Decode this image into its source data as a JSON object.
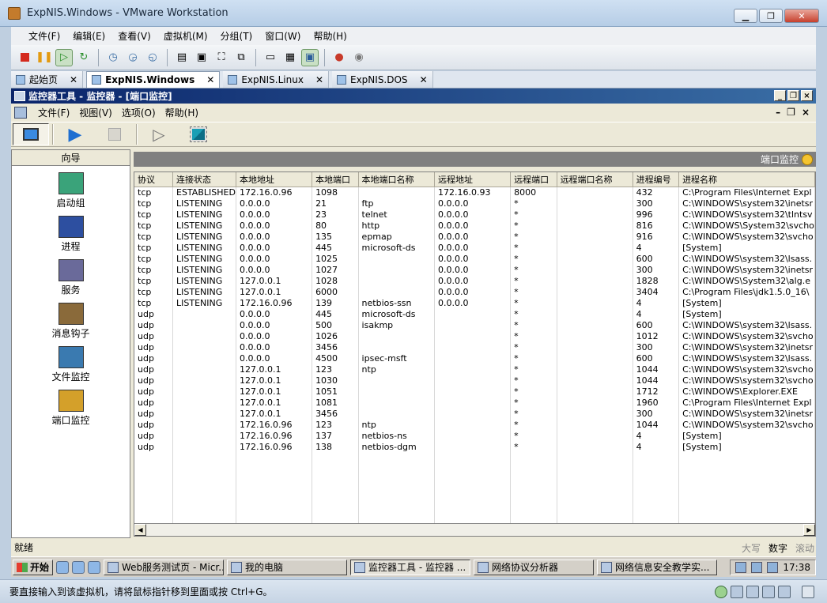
{
  "vm": {
    "title": "ExpNIS.Windows - VMware Workstation",
    "menu": [
      "文件(F)",
      "编辑(E)",
      "查看(V)",
      "虚拟机(M)",
      "分组(T)",
      "窗口(W)",
      "帮助(H)"
    ],
    "tabs": [
      {
        "label": "起始页",
        "active": false
      },
      {
        "label": "ExpNIS.Windows",
        "active": true
      },
      {
        "label": "ExpNIS.Linux",
        "active": false
      },
      {
        "label": "ExpNIS.DOS",
        "active": false
      }
    ],
    "status_text": "要直接输入到该虚拟机，请将鼠标指针移到里面或按 Ctrl+G。"
  },
  "app": {
    "title": "监控器工具 - 监控器 - [端口监控]",
    "menu": [
      "文件(F)",
      "视图(V)",
      "选项(O)",
      "帮助(H)"
    ],
    "nav_header": "向导",
    "nav_items": [
      {
        "label": "启动组",
        "icon": "startup-group-icon"
      },
      {
        "label": "进程",
        "icon": "process-icon"
      },
      {
        "label": "服务",
        "icon": "service-icon"
      },
      {
        "label": "消息钩子",
        "icon": "message-hook-icon"
      },
      {
        "label": "文件监控",
        "icon": "file-monitor-icon"
      },
      {
        "label": "端口监控",
        "icon": "port-monitor-icon"
      }
    ],
    "panel_title": "端口监控",
    "status": "就绪",
    "indicators": [
      "大写",
      "数字",
      "滚动"
    ]
  },
  "table": {
    "columns": [
      "协议",
      "连接状态",
      "本地地址",
      "本地端口",
      "本地端口名称",
      "远程地址",
      "远程端口",
      "远程端口名称",
      "进程编号",
      "进程名称"
    ],
    "rows": [
      [
        "tcp",
        "ESTABLISHED",
        "172.16.0.96",
        "1098",
        "",
        "172.16.0.93",
        "8000",
        "",
        "432",
        "C:\\Program Files\\Internet Expl"
      ],
      [
        "tcp",
        "LISTENING",
        "0.0.0.0",
        "21",
        "ftp",
        "0.0.0.0",
        "*",
        "",
        "300",
        "C:\\WINDOWS\\system32\\inetsr"
      ],
      [
        "tcp",
        "LISTENING",
        "0.0.0.0",
        "23",
        "telnet",
        "0.0.0.0",
        "*",
        "",
        "996",
        "C:\\WINDOWS\\system32\\tlntsv"
      ],
      [
        "tcp",
        "LISTENING",
        "0.0.0.0",
        "80",
        "http",
        "0.0.0.0",
        "*",
        "",
        "816",
        "C:\\WINDOWS\\System32\\svcho"
      ],
      [
        "tcp",
        "LISTENING",
        "0.0.0.0",
        "135",
        "epmap",
        "0.0.0.0",
        "*",
        "",
        "916",
        "C:\\WINDOWS\\system32\\svcho"
      ],
      [
        "tcp",
        "LISTENING",
        "0.0.0.0",
        "445",
        "microsoft-ds",
        "0.0.0.0",
        "*",
        "",
        "4",
        "[System]"
      ],
      [
        "tcp",
        "LISTENING",
        "0.0.0.0",
        "1025",
        "",
        "0.0.0.0",
        "*",
        "",
        "600",
        "C:\\WINDOWS\\system32\\lsass."
      ],
      [
        "tcp",
        "LISTENING",
        "0.0.0.0",
        "1027",
        "",
        "0.0.0.0",
        "*",
        "",
        "300",
        "C:\\WINDOWS\\system32\\inetsr"
      ],
      [
        "tcp",
        "LISTENING",
        "127.0.0.1",
        "1028",
        "",
        "0.0.0.0",
        "*",
        "",
        "1828",
        "C:\\WINDOWS\\System32\\alg.e"
      ],
      [
        "tcp",
        "LISTENING",
        "127.0.0.1",
        "6000",
        "",
        "0.0.0.0",
        "*",
        "",
        "3404",
        "C:\\Program Files\\jdk1.5.0_16\\"
      ],
      [
        "tcp",
        "LISTENING",
        "172.16.0.96",
        "139",
        "netbios-ssn",
        "0.0.0.0",
        "*",
        "",
        "4",
        "[System]"
      ],
      [
        "udp",
        "",
        "0.0.0.0",
        "445",
        "microsoft-ds",
        "",
        "*",
        "",
        "4",
        "[System]"
      ],
      [
        "udp",
        "",
        "0.0.0.0",
        "500",
        "isakmp",
        "",
        "*",
        "",
        "600",
        "C:\\WINDOWS\\system32\\lsass."
      ],
      [
        "udp",
        "",
        "0.0.0.0",
        "1026",
        "",
        "",
        "*",
        "",
        "1012",
        "C:\\WINDOWS\\system32\\svcho"
      ],
      [
        "udp",
        "",
        "0.0.0.0",
        "3456",
        "",
        "",
        "*",
        "",
        "300",
        "C:\\WINDOWS\\system32\\inetsr"
      ],
      [
        "udp",
        "",
        "0.0.0.0",
        "4500",
        "ipsec-msft",
        "",
        "*",
        "",
        "600",
        "C:\\WINDOWS\\system32\\lsass."
      ],
      [
        "udp",
        "",
        "127.0.0.1",
        "123",
        "ntp",
        "",
        "*",
        "",
        "1044",
        "C:\\WINDOWS\\system32\\svcho"
      ],
      [
        "udp",
        "",
        "127.0.0.1",
        "1030",
        "",
        "",
        "*",
        "",
        "1044",
        "C:\\WINDOWS\\system32\\svcho"
      ],
      [
        "udp",
        "",
        "127.0.0.1",
        "1051",
        "",
        "",
        "*",
        "",
        "1712",
        "C:\\WINDOWS\\Explorer.EXE"
      ],
      [
        "udp",
        "",
        "127.0.0.1",
        "1081",
        "",
        "",
        "*",
        "",
        "1960",
        "C:\\Program Files\\Internet Expl"
      ],
      [
        "udp",
        "",
        "127.0.0.1",
        "3456",
        "",
        "",
        "*",
        "",
        "300",
        "C:\\WINDOWS\\system32\\inetsr"
      ],
      [
        "udp",
        "",
        "172.16.0.96",
        "123",
        "ntp",
        "",
        "*",
        "",
        "1044",
        "C:\\WINDOWS\\system32\\svcho"
      ],
      [
        "udp",
        "",
        "172.16.0.96",
        "137",
        "netbios-ns",
        "",
        "*",
        "",
        "4",
        "[System]"
      ],
      [
        "udp",
        "",
        "172.16.0.96",
        "138",
        "netbios-dgm",
        "",
        "*",
        "",
        "4",
        "[System]"
      ]
    ]
  },
  "taskbar": {
    "start": "开始",
    "tasks": [
      {
        "label": "Web服务测试页 - Micr...",
        "active": false
      },
      {
        "label": "我的电脑",
        "active": false
      },
      {
        "label": "监控器工具 - 监控器 ...",
        "active": true
      },
      {
        "label": "网络协议分析器",
        "active": false
      },
      {
        "label": "网络信息安全教学实...",
        "active": false
      }
    ],
    "clock": "17:38"
  }
}
